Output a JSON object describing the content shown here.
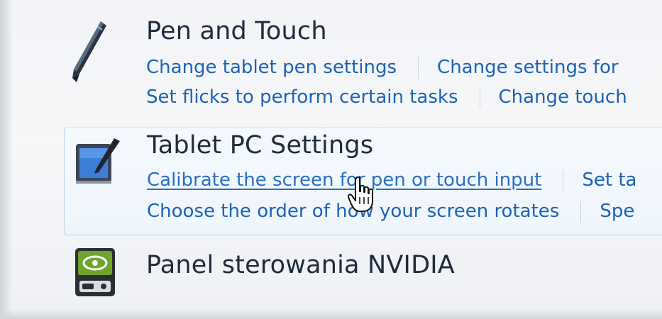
{
  "pen_and_touch": {
    "title": "Pen and Touch",
    "links_row1": [
      "Change tablet pen settings",
      "Change settings for"
    ],
    "links_row2": [
      "Set flicks to perform certain tasks",
      "Change touch"
    ]
  },
  "tablet_pc": {
    "title": "Tablet PC Settings",
    "links_row1": [
      "Calibrate the screen for pen or touch input",
      "Set ta"
    ],
    "links_row2": [
      "Choose the order of how your screen rotates",
      "Spe"
    ]
  },
  "nvidia": {
    "title": "Panel sterowania NVIDIA"
  },
  "icons": {
    "pen": "pen-icon",
    "tablet": "tablet-pc-icon",
    "nvidia": "nvidia-icon",
    "cursor": "hand-pointer-cursor"
  },
  "colors": {
    "link": "#1b63b6",
    "title": "#1f2b3a",
    "highlight_border": "#b9d3ec"
  }
}
